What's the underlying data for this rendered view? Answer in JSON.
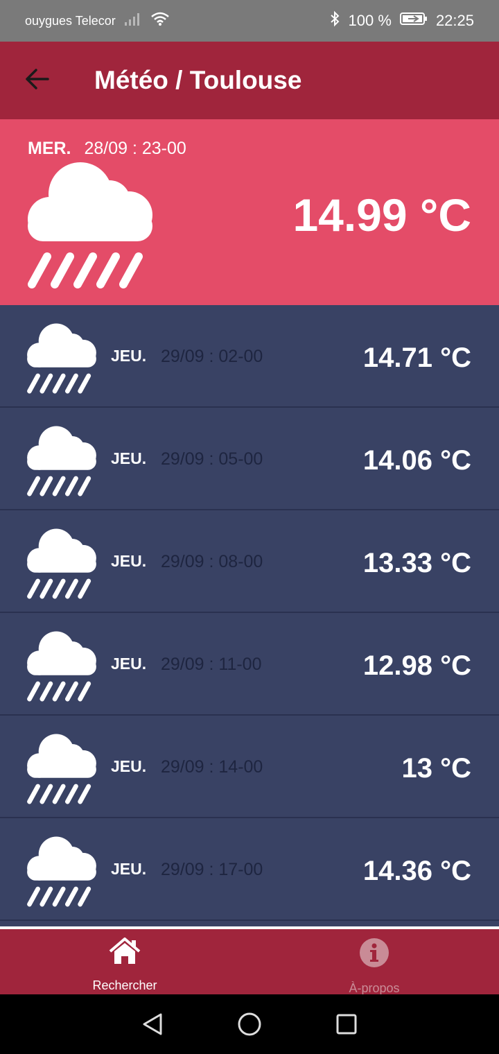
{
  "status": {
    "carrier": "ouygues Telecor",
    "battery": "100 %",
    "time": "22:25"
  },
  "app_bar": {
    "title": "Météo / Toulouse"
  },
  "current": {
    "day": "MER.",
    "date": "28/09 : 23-00",
    "temp": "14.99 °C",
    "icon": "rain-cloud-icon"
  },
  "forecast": [
    {
      "day": "JEU.",
      "date": "29/09 : 02-00",
      "temp": "14.71 °C"
    },
    {
      "day": "JEU.",
      "date": "29/09 : 05-00",
      "temp": "14.06 °C"
    },
    {
      "day": "JEU.",
      "date": "29/09 : 08-00",
      "temp": "13.33 °C"
    },
    {
      "day": "JEU.",
      "date": "29/09 : 11-00",
      "temp": "12.98 °C"
    },
    {
      "day": "JEU.",
      "date": "29/09 : 14-00",
      "temp": "13 °C"
    },
    {
      "day": "JEU.",
      "date": "29/09 : 17-00",
      "temp": "14.36 °C"
    }
  ],
  "bottom_nav": {
    "search_label": "Rechercher",
    "about_label": "À-propos"
  },
  "colors": {
    "primary": "#a0253c",
    "current_bg": "#e44c68",
    "list_bg": "#394264"
  }
}
